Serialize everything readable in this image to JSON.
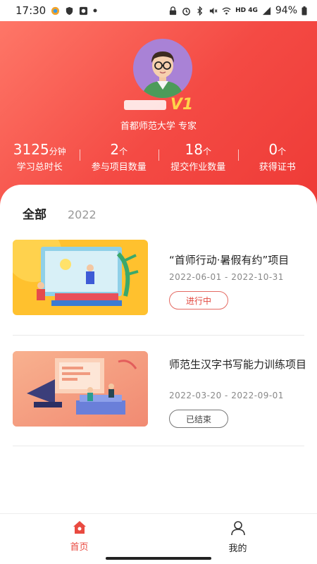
{
  "status": {
    "time": "17:30",
    "network": "HD 4G",
    "battery": "94%"
  },
  "profile": {
    "name_suffix": "V1",
    "school": "首都师范大学 专家"
  },
  "stats": [
    {
      "value": "3125",
      "unit": "分钟",
      "label": "学习总时长"
    },
    {
      "value": "2",
      "unit": "个",
      "label": "参与项目数量"
    },
    {
      "value": "18",
      "unit": "个",
      "label": "提交作业数量"
    },
    {
      "value": "0",
      "unit": "个",
      "label": "获得证书"
    }
  ],
  "tabs": [
    {
      "label": "全部",
      "active": true
    },
    {
      "label": "2022",
      "active": false
    }
  ],
  "projects": [
    {
      "title": "“首师行动·暑假有约”项目",
      "date": "2022-06-01 - 2022-10-31",
      "status": "进行中"
    },
    {
      "title": "师范生汉字书写能力训练项目",
      "date": "2022-03-20 - 2022-09-01",
      "status": "已结束"
    }
  ],
  "nav": [
    {
      "label": "首页",
      "icon": "home-icon",
      "active": true
    },
    {
      "label": "我的",
      "icon": "user-icon",
      "active": false
    }
  ],
  "colors": {
    "accent": "#f44a44",
    "level": "#ffd34a"
  }
}
